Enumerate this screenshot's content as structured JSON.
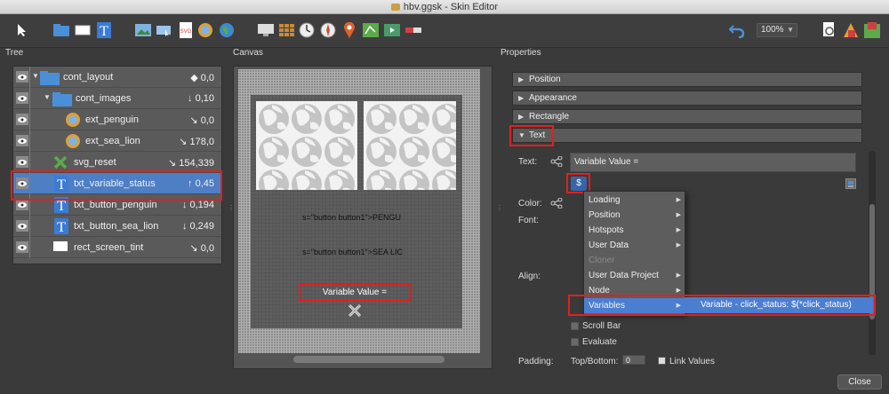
{
  "window": {
    "title": "hbv.ggsk - Skin Editor"
  },
  "toolbar": {
    "zoom": "100%"
  },
  "panels": {
    "tree": "Tree",
    "canvas": "Canvas",
    "properties": "Properties"
  },
  "tree": {
    "rows": [
      {
        "label": "cont_layout",
        "value": "◆ 0,0"
      },
      {
        "label": "cont_images",
        "value": "↓ 0,10"
      },
      {
        "label": "ext_penguin",
        "value": "↘ 0,0"
      },
      {
        "label": "ext_sea_lion",
        "value": "↘ 178,0"
      },
      {
        "label": "svg_reset",
        "value": "↘ 154,339"
      },
      {
        "label": "txt_variable_status",
        "value": "↑ 0,45"
      },
      {
        "label": "txt_button_penguin",
        "value": "↓ 0,194"
      },
      {
        "label": "txt_button_sea_lion",
        "value": "↓ 0,249"
      },
      {
        "label": "rect_screen_tint",
        "value": "↘ 0,0"
      }
    ]
  },
  "canvas": {
    "text1": "s=\"button button1\">PENGU",
    "text2": "s=\"button button1\">SEA LIC",
    "variable_value": "Variable Value ="
  },
  "properties": {
    "sections": [
      "Position",
      "Appearance",
      "Rectangle",
      "Text"
    ],
    "text_label": "Text:",
    "text_value": "Variable Value =",
    "color_label": "Color:",
    "font_label": "Font:",
    "align_label": "Align:",
    "padding_label": "Padding:",
    "top_bottom_label": "Top/Bottom:",
    "top_bottom_value": "0",
    "link_values": "Link Values",
    "scroll_bar": "Scroll Bar",
    "evaluate": "Evaluate",
    "dollar": "$"
  },
  "menu": {
    "items": [
      {
        "label": "Loading",
        "submenu": true,
        "disabled": false
      },
      {
        "label": "Position",
        "submenu": true,
        "disabled": false
      },
      {
        "label": "Hotspots",
        "submenu": true,
        "disabled": false
      },
      {
        "label": "User Data",
        "submenu": true,
        "disabled": false
      },
      {
        "label": "Cloner",
        "submenu": false,
        "disabled": true
      },
      {
        "label": "User Data Project",
        "submenu": true,
        "disabled": false
      },
      {
        "label": "Node",
        "submenu": true,
        "disabled": false
      },
      {
        "label": "Variables",
        "submenu": true,
        "disabled": false,
        "highlighted": true
      }
    ],
    "submenu_item": "Variable - click_status: $(*click_status)"
  },
  "footer": {
    "close": "Close"
  },
  "colors": {
    "selection": "#4e7ec4",
    "annotation": "#e02020",
    "menu_highlight": "#4a7ed0"
  }
}
